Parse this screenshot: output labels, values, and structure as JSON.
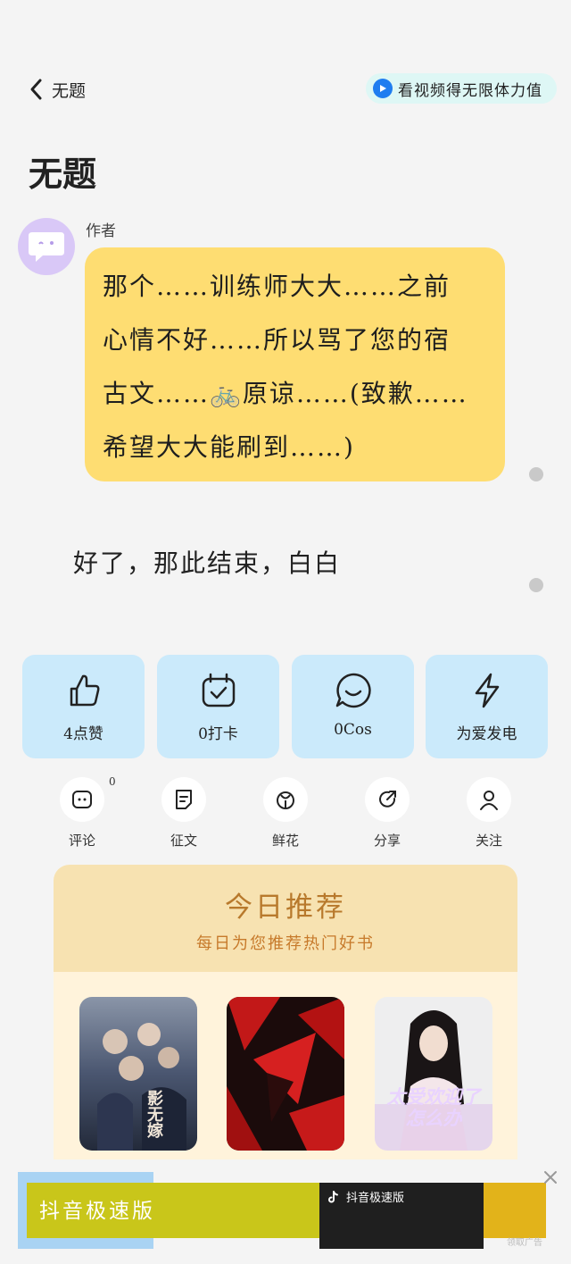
{
  "header": {
    "back_label": "无题",
    "promo_label": "看视频得无限体力值"
  },
  "post": {
    "title": "无题",
    "author_label": "作者",
    "bubble_lines": [
      "那个……训练师大大……之前",
      "心情不好……所以骂了您的宿",
      "古文……🚲原谅……(致歉……",
      "希望大大能刷到……)"
    ],
    "plain_message": "好了，那此结束，白白"
  },
  "actions": [
    {
      "label": "4点赞",
      "icon": "thumbs-up-icon"
    },
    {
      "label": "0打卡",
      "icon": "calendar-check-icon"
    },
    {
      "label": "0Cos",
      "icon": "chat-smile-icon"
    },
    {
      "label": "为爱发电",
      "icon": "lightning-icon"
    }
  ],
  "mini_actions": [
    {
      "label": "评论",
      "icon": "comment-icon"
    },
    {
      "label": "征文",
      "icon": "document-icon"
    },
    {
      "label": "鲜花",
      "icon": "flower-icon"
    },
    {
      "label": "分享",
      "icon": "share-icon"
    },
    {
      "label": "关注",
      "icon": "person-icon"
    }
  ],
  "comment_count": "0",
  "recommend": {
    "title": "今日推荐",
    "subtitle": "每日为您推荐热门好书",
    "books": [
      {
        "cover_text": "影无嫁"
      },
      {
        "cover_text": ""
      },
      {
        "cover_text": "太受欢迎了怎么办"
      }
    ]
  },
  "ad": {
    "headline": "抖音极速版",
    "app_name": "抖音极速版",
    "tag": "领取广告"
  },
  "colors": {
    "bubble": "#fedd72",
    "card": "#cbeafb",
    "rec_header": "#f7e2b1",
    "accent_orange": "#c77a2b"
  }
}
